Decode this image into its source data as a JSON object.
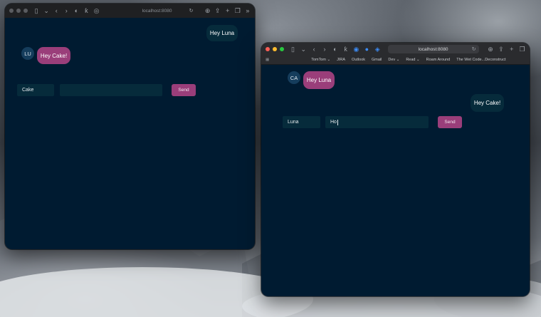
{
  "background": {
    "description_icon": "mountain-clouds-wallpaper"
  },
  "colors": {
    "window_bg": "#001b31",
    "my_bubble": "#062b3b",
    "their_bubble": "#9a3e7a",
    "send_button": "#9a3e7a",
    "avatar_bg": "#153d5c"
  },
  "left_window": {
    "url": "localhost:8080",
    "messages": [
      {
        "from": "me",
        "text": "Hey Luna"
      },
      {
        "from": "other",
        "avatar": "LU",
        "text": "Hey Cake!"
      }
    ],
    "name_value": "Cake",
    "message_value": "",
    "send_label": "Send"
  },
  "right_window": {
    "url": "localhost:8080",
    "bookmarks": [
      "TomTom ⌄",
      "JIRA",
      "Outlook",
      "Gmail",
      "Dev ⌄",
      "Read ⌄",
      "Roam Around",
      "The Wet Code...Deconstruct"
    ],
    "messages": [
      {
        "from": "other",
        "avatar": "CA",
        "text": "Hey Luna"
      },
      {
        "from": "me",
        "text": "Hey Cake!"
      }
    ],
    "name_value": "Luna",
    "message_value": "Ho",
    "send_label": "Send"
  }
}
